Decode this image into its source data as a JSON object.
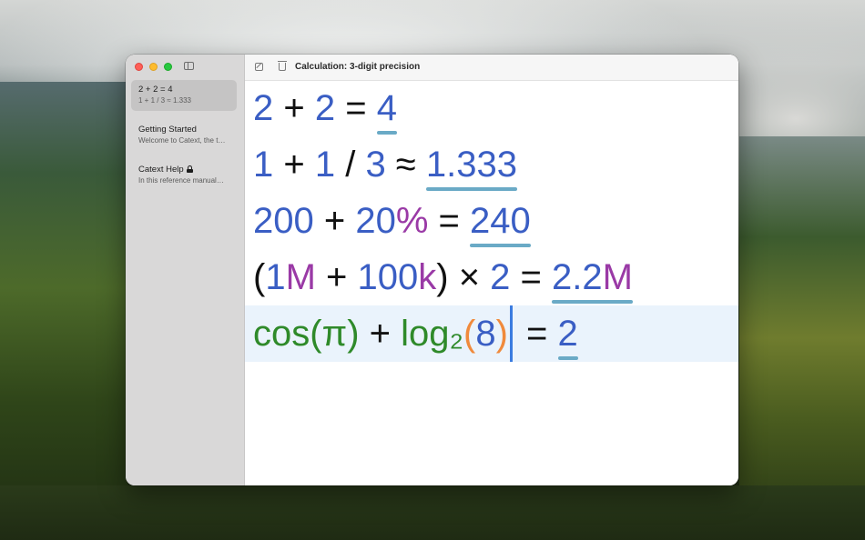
{
  "window": {
    "title": "Calculation: 3-digit precision"
  },
  "sidebar": {
    "items": [
      {
        "title": "2 + 2 = 4",
        "preview": "1 + 1 / 3 ≈ 1.333",
        "selected": true
      },
      {
        "title": "Getting Started",
        "preview": "Welcome to Catext, the t…",
        "selected": false
      },
      {
        "title": "Catext Help",
        "preview": "In this reference manual…",
        "selected": false,
        "locked": true
      }
    ]
  },
  "editor": {
    "lines": [
      {
        "parts": [
          "2",
          " + ",
          "2",
          " = "
        ],
        "result": "4"
      },
      {
        "parts": [
          "1",
          " + ",
          "1",
          " / ",
          "3",
          " ≈ "
        ],
        "result": "1.333"
      },
      {
        "parts": [
          "200",
          " + ",
          "20",
          "%",
          " = "
        ],
        "result": "240"
      },
      {
        "parts": [
          "(",
          "1",
          "M",
          " + ",
          "100",
          "k",
          ")",
          " × ",
          "2",
          " = "
        ],
        "result_num": "2.2",
        "result_unit": "M"
      },
      {
        "parts": [
          "cos",
          "(",
          "π",
          ")",
          " + ",
          "log₂",
          "(",
          "8",
          ")",
          " = "
        ],
        "result": "2",
        "current": true
      }
    ]
  },
  "colors": {
    "number": "#3a5ec4",
    "operator": "#111111",
    "percent_unit": "#9a3aa6",
    "function": "#2f8a2a",
    "paren_highlight": "#f08a3c",
    "result_underline": "#6aaac6",
    "cursor": "#3a7be0",
    "current_line_bg": "#eaf3fc"
  },
  "icons": [
    "close-dot",
    "minimize-dot",
    "zoom-dot",
    "sidebar-toggle-icon",
    "compose-icon",
    "trash-icon",
    "lock-icon"
  ]
}
